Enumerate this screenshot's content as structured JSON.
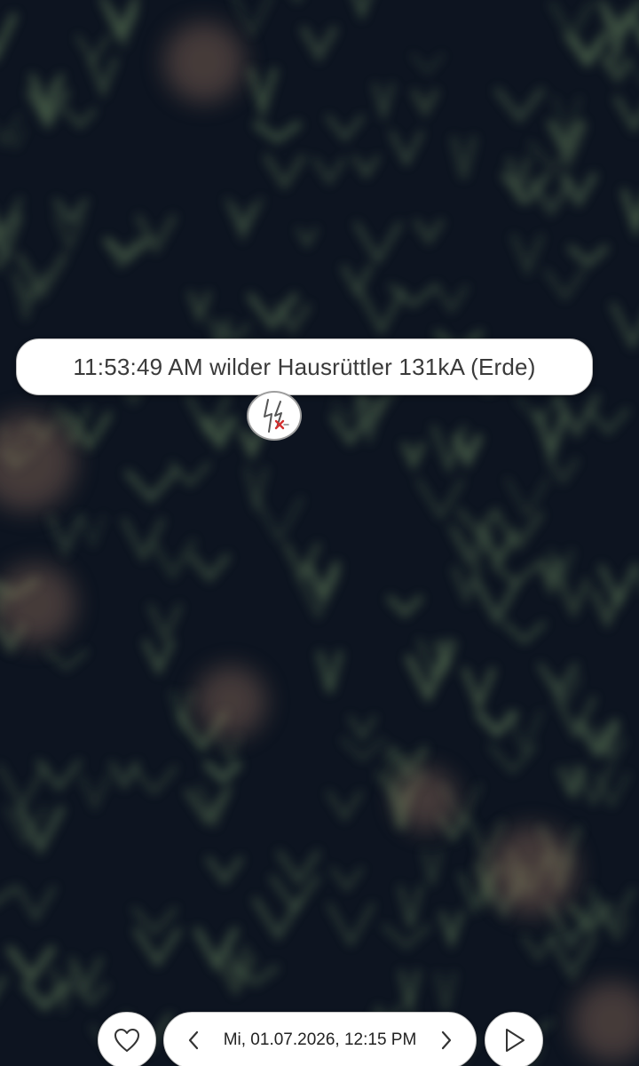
{
  "map": {
    "background": "#0d1420",
    "tree_color": "#5f7a57"
  },
  "strike": {
    "info": "11:53:49 AM wilder Hausrüttler 131kA (Erde)",
    "marker_icon": "lightning-strike-icon",
    "marker_accent": "#d32f2f"
  },
  "bottom_bar": {
    "favorite_icon": "heart-icon",
    "prev_icon": "chevron-left-icon",
    "date": "Mi, 01.07.2026, 12:15 PM",
    "next_icon": "chevron-right-icon",
    "play_icon": "play-icon"
  }
}
